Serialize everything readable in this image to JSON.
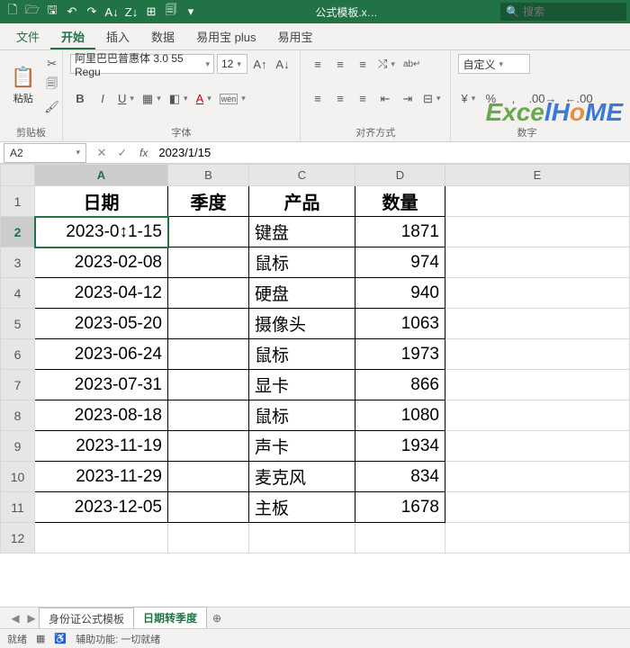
{
  "titlebar": {
    "doc_name": "公式模板.x…",
    "search_placeholder": "搜索"
  },
  "tabs": {
    "file": "文件",
    "home": "开始",
    "insert": "插入",
    "data": "数据",
    "eyb_plus": "易用宝 plus",
    "eyb": "易用宝"
  },
  "ribbon": {
    "clipboard_group": "剪贴板",
    "paste_label": "粘贴",
    "font_group": "字体",
    "font_name": "阿里巴巴普惠体 3.0 55 Regu",
    "font_size": "12",
    "align_group": "对齐方式",
    "number_group": "数字",
    "number_format": "自定义"
  },
  "namebox": "A2",
  "formula": "2023/1/15",
  "columns": [
    "A",
    "B",
    "C",
    "D",
    "E"
  ],
  "headers": {
    "A": "日期",
    "B": "季度",
    "C": "产品",
    "D": "数量"
  },
  "rows": [
    {
      "n": 1
    },
    {
      "n": 2,
      "date": "2023-01-15",
      "product": "键盘",
      "qty": "1871"
    },
    {
      "n": 3,
      "date": "2023-02-08",
      "product": "鼠标",
      "qty": "974"
    },
    {
      "n": 4,
      "date": "2023-04-12",
      "product": "硬盘",
      "qty": "940"
    },
    {
      "n": 5,
      "date": "2023-05-20",
      "product": "摄像头",
      "qty": "1063"
    },
    {
      "n": 6,
      "date": "2023-06-24",
      "product": "鼠标",
      "qty": "1973"
    },
    {
      "n": 7,
      "date": "2023-07-31",
      "product": "显卡",
      "qty": "866"
    },
    {
      "n": 8,
      "date": "2023-08-18",
      "product": "鼠标",
      "qty": "1080"
    },
    {
      "n": 9,
      "date": "2023-11-19",
      "product": "声卡",
      "qty": "1934"
    },
    {
      "n": 10,
      "date": "2023-11-29",
      "product": "麦克风",
      "qty": "834"
    },
    {
      "n": 11,
      "date": "2023-12-05",
      "product": "主板",
      "qty": "1678"
    },
    {
      "n": 12
    }
  ],
  "active_cell_display": "2023-0↕1-15",
  "sheets": {
    "sheet1": "身份证公式模板",
    "sheet2": "日期转季度"
  },
  "status": {
    "ready": "就绪",
    "access": "辅助功能: 一切就绪"
  },
  "active": {
    "col": "A",
    "row": 2
  }
}
